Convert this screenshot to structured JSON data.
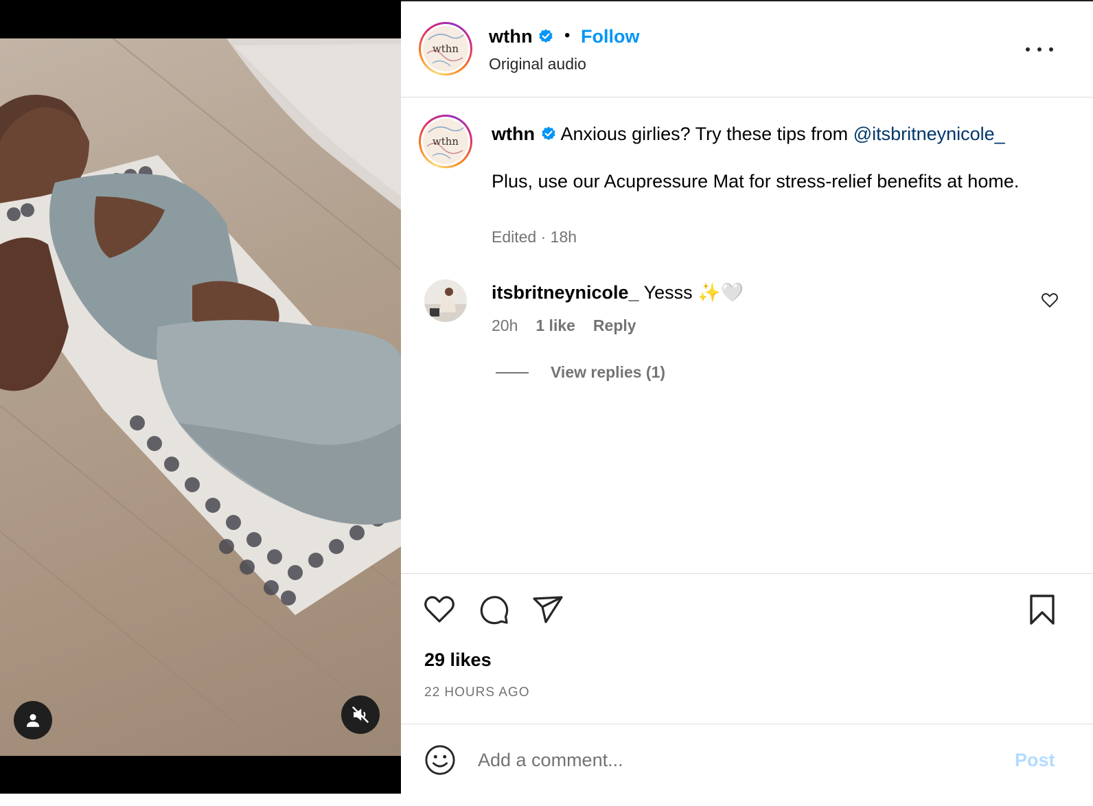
{
  "header": {
    "username": "wthn",
    "separator": "•",
    "follow_label": "Follow",
    "subtitle": "Original audio",
    "avatar_text": "wthn"
  },
  "caption": {
    "username": "wthn",
    "text": "Anxious girlies? Try these tips from ",
    "mention": "@itsbritneynicole_",
    "body": "Plus, use our Acupressure Mat for stress-relief benefits at home.",
    "edited": "Edited",
    "time": "18h"
  },
  "comment": {
    "username": "itsbritneynicole_",
    "text": "Yesss ✨🤍",
    "time": "20h",
    "likes": "1 like",
    "reply_label": "Reply",
    "view_replies": "View replies (1)"
  },
  "actions": {
    "likes": "29 likes",
    "time_ago": "22 HOURS AGO"
  },
  "add_comment": {
    "placeholder": "Add a comment...",
    "post_label": "Post"
  },
  "colors": {
    "accent": "#0095f6",
    "mention": "#00376b",
    "muted": "#737373",
    "post_disabled": "#b3dbff"
  },
  "icons": [
    "verified-badge-icon",
    "more-icon",
    "heart-icon",
    "comment-icon",
    "share-icon",
    "save-icon",
    "emoji-icon",
    "user-tag-icon",
    "muted-speaker-icon"
  ]
}
